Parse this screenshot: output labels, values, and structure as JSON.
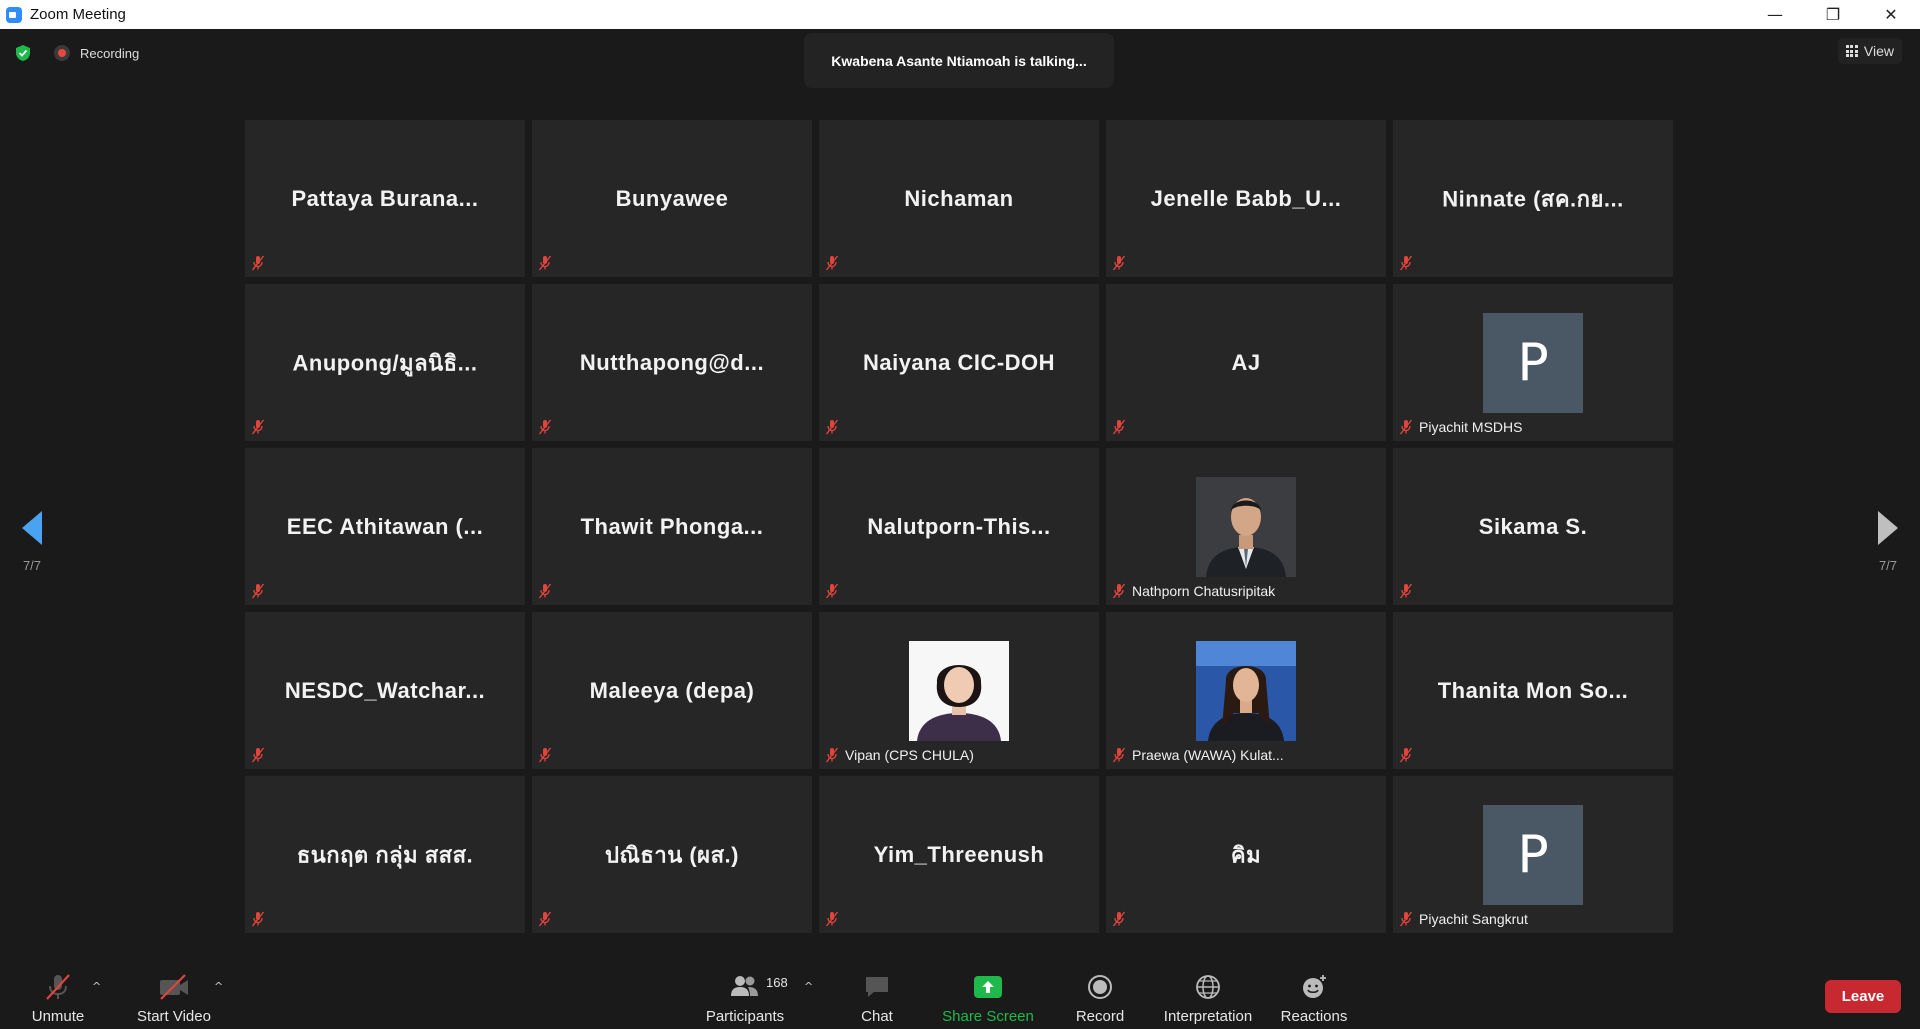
{
  "window": {
    "title": "Zoom Meeting",
    "minimize_glyph": "—",
    "restore_glyph": "❐",
    "close_glyph": "✕"
  },
  "status": {
    "recording_label": "Recording",
    "talking_text": "Kwabena Asante Ntiamoah is talking...",
    "view_label": "View"
  },
  "pagination": {
    "left": "7/7",
    "right": "7/7"
  },
  "participants": [
    {
      "big": "Pattaya  Burana...",
      "label": ""
    },
    {
      "big": "Bunyawee",
      "label": ""
    },
    {
      "big": "Nichaman",
      "label": ""
    },
    {
      "big": "Jenelle  Babb_U...",
      "label": ""
    },
    {
      "big": "Ninnate  (สค.กย...",
      "label": ""
    },
    {
      "big": "Anupong/มูลนิธิ...",
      "label": ""
    },
    {
      "big": "Nutthapong@d...",
      "label": ""
    },
    {
      "big": "Naiyana CIC-DOH",
      "label": ""
    },
    {
      "big": "AJ",
      "label": ""
    },
    {
      "big": "",
      "label": "Piyachit MSDHS",
      "avatar": "P"
    },
    {
      "big": "EEC  Athitawan  (...",
      "label": ""
    },
    {
      "big": "Thawit  Phonga...",
      "label": ""
    },
    {
      "big": "Nalutporn-This...",
      "label": ""
    },
    {
      "big": "",
      "label": "Nathporn Chatusripitak",
      "photo": "man-suit"
    },
    {
      "big": "Sikama S.",
      "label": ""
    },
    {
      "big": "NESDC_Watchar...",
      "label": ""
    },
    {
      "big": "Maleeya (depa)",
      "label": ""
    },
    {
      "big": "",
      "label": "Vipan  (CPS  CHULA)",
      "photo": "woman-white"
    },
    {
      "big": "",
      "label": "Praewa (WAWA) Kulat...",
      "photo": "woman-blue"
    },
    {
      "big": "Thanita Mon So...",
      "label": ""
    },
    {
      "big": "ธนกฤต กลุ่ม สสส.",
      "label": ""
    },
    {
      "big": "ปณิธาน (ผส.)",
      "label": ""
    },
    {
      "big": "Yim_Threenush",
      "label": ""
    },
    {
      "big": "คิม",
      "label": ""
    },
    {
      "big": "",
      "label": "Piyachit Sangkrut",
      "avatar": "P"
    }
  ],
  "toolbar": {
    "unmute": "Unmute",
    "start_video": "Start Video",
    "participants": "Participants",
    "participant_count": "168",
    "chat": "Chat",
    "share_screen": "Share Screen",
    "record": "Record",
    "interpretation": "Interpretation",
    "reactions": "Reactions",
    "leave": "Leave",
    "caret_glyph": "^"
  },
  "colors": {
    "leave": "#c8282f",
    "share_green": "#1fb84a",
    "muted_red": "#e0453c",
    "arrow_blue": "#4aa3f0",
    "tile_bg": "#262626"
  }
}
